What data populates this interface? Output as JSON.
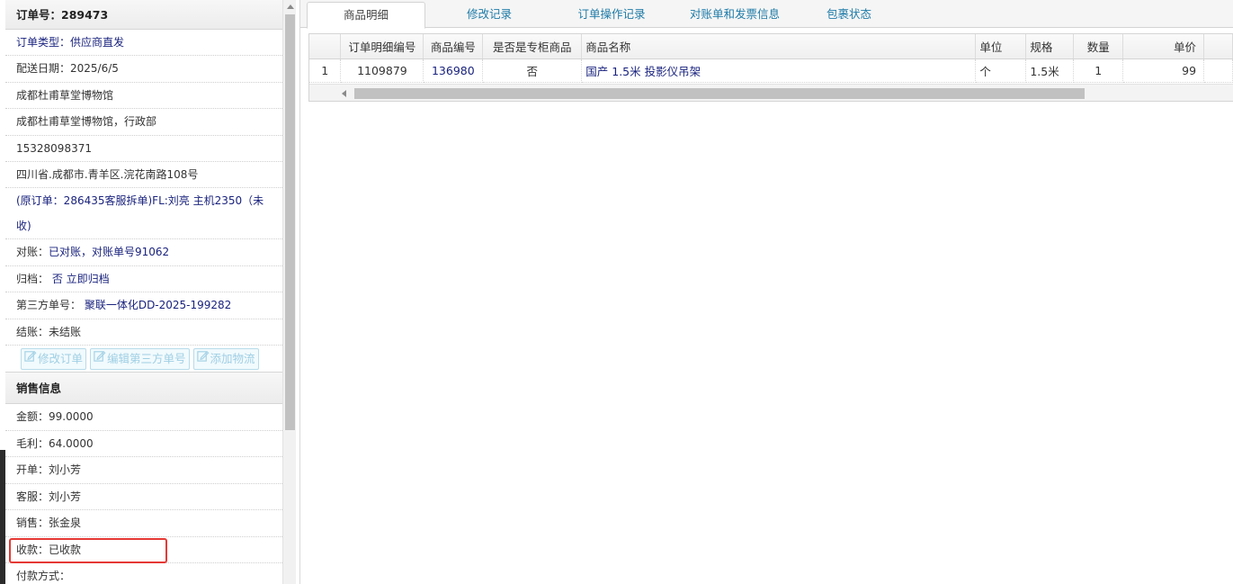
{
  "order": {
    "header": "订单号：289473",
    "rows": [
      {
        "text": "订单类型：供应商直发",
        "blue": true
      },
      {
        "text": "配送日期：2025/6/5",
        "blue": false
      },
      {
        "text": "成都杜甫草堂博物馆",
        "blue": false
      },
      {
        "text": "成都杜甫草堂博物馆，行政部",
        "blue": false
      },
      {
        "text": "15328098371",
        "blue": false
      },
      {
        "text": "四川省.成都市.青羊区.浣花南路108号",
        "blue": false
      }
    ],
    "original_order": "(原订单：286435客服拆单)FL:刘亮 主机2350（未收)",
    "reconcile_label": "对账：",
    "reconcile_value": "已对账，对账单号91062",
    "archive_label": "归档：",
    "archive_value": " 否 立即归档",
    "third_party_label": "第三方单号：",
    "third_party_value": " 聚联一体化DD-2025-199282",
    "settle": "结账：未结账",
    "buttons": {
      "edit_order": "修改订单",
      "edit_third": "编辑第三方单号",
      "add_logistics": "添加物流"
    }
  },
  "sales": {
    "header": "销售信息",
    "amount": "金额：99.0000",
    "gross_profit": "毛利：64.0000",
    "issuer": "开单：刘小芳",
    "service": "客服：刘小芳",
    "seller": "销售：张金泉",
    "payment_received": "收款：已收款",
    "payment_method": "付款方式："
  },
  "tabs": [
    {
      "label": "商品明细",
      "active": true
    },
    {
      "label": "修改记录",
      "active": false
    },
    {
      "label": "订单操作记录",
      "active": false
    },
    {
      "label": "对账单和发票信息",
      "active": false
    },
    {
      "label": "包裹状态",
      "active": false
    }
  ],
  "grid": {
    "columns": [
      "",
      "订单明细编号",
      "商品编号",
      "是否是专柜商品",
      "商品名称",
      "单位",
      "规格",
      "数量",
      "单价",
      ""
    ],
    "rows": [
      [
        "1",
        "1109879",
        "136980",
        "否",
        "国产 1.5米 投影仪吊架",
        "个",
        "1.5米",
        "1",
        "99",
        ""
      ]
    ]
  }
}
